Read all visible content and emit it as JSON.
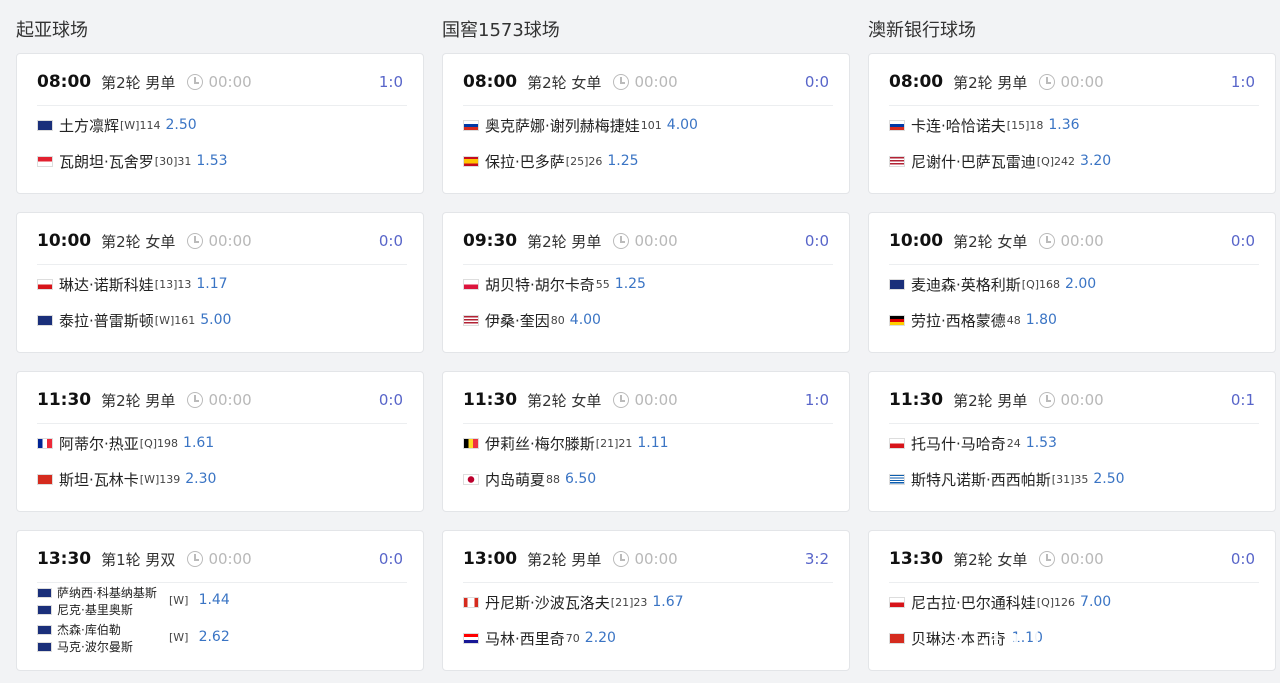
{
  "courts": [
    {
      "name": "起亚球场",
      "matches": [
        {
          "time": "08:00",
          "round": "第2轮 男单",
          "elapsed": "00:00",
          "score": "1:0",
          "p1": {
            "name": "土方凛辉",
            "seed": "[W]114",
            "odds": "2.50",
            "flag": "AUS"
          },
          "p2": {
            "name": "瓦朗坦·瓦舍罗",
            "seed": "[30]31",
            "odds": "1.53",
            "flag": "MON"
          }
        },
        {
          "time": "10:00",
          "round": "第2轮 女单",
          "elapsed": "00:00",
          "score": "0:0",
          "p1": {
            "name": "琳达·诺斯科娃",
            "seed": "[13]13",
            "odds": "1.17",
            "flag": "CZE"
          },
          "p2": {
            "name": "泰拉·普雷斯顿",
            "seed": "[W]161",
            "odds": "5.00",
            "flag": "AUS"
          }
        },
        {
          "time": "11:30",
          "round": "第2轮 男单",
          "elapsed": "00:00",
          "score": "0:0",
          "p1": {
            "name": "阿蒂尔·热亚",
            "seed": "[Q]198",
            "odds": "1.61",
            "flag": "FRA"
          },
          "p2": {
            "name": "斯坦·瓦林卡",
            "seed": "[W]139",
            "odds": "2.30",
            "flag": "SUI"
          }
        },
        {
          "time": "13:30",
          "round": "第1轮 男双",
          "elapsed": "00:00",
          "score": "0:0",
          "team1": {
            "players": [
              "萨纳西·科基纳基斯",
              "尼克·基里奥斯"
            ],
            "flags": [
              "AUS",
              "AUS"
            ],
            "seed": "[W]",
            "odds": "1.44"
          },
          "team2": {
            "players": [
              "杰森·库伯勒",
              "马克·波尔曼斯"
            ],
            "flags": [
              "AUS",
              "AUS"
            ],
            "seed": "[W]",
            "odds": "2.62"
          }
        }
      ]
    },
    {
      "name": "国窖1573球场",
      "matches": [
        {
          "time": "08:00",
          "round": "第2轮 女单",
          "elapsed": "00:00",
          "score": "0:0",
          "p1": {
            "name": "奥克萨娜·谢列赫梅捷娃",
            "seed": "101",
            "odds": "4.00",
            "flag": "RUS"
          },
          "p2": {
            "name": "保拉·巴多萨",
            "seed": "[25]26",
            "odds": "1.25",
            "flag": "ESP"
          }
        },
        {
          "time": "09:30",
          "round": "第2轮 男单",
          "elapsed": "00:00",
          "score": "0:0",
          "p1": {
            "name": "胡贝特·胡尔卡奇",
            "seed": "55",
            "odds": "1.25",
            "flag": "POL"
          },
          "p2": {
            "name": "伊桑·奎因",
            "seed": "80",
            "odds": "4.00",
            "flag": "USA"
          }
        },
        {
          "time": "11:30",
          "round": "第2轮 女单",
          "elapsed": "00:00",
          "score": "1:0",
          "p1": {
            "name": "伊莉丝·梅尔滕斯",
            "seed": "[21]21",
            "odds": "1.11",
            "flag": "BEL"
          },
          "p2": {
            "name": "内岛萌夏",
            "seed": "88",
            "odds": "6.50",
            "flag": "JPN"
          }
        },
        {
          "time": "13:00",
          "round": "第2轮 男单",
          "elapsed": "00:00",
          "score": "3:2",
          "p1": {
            "name": "丹尼斯·沙波瓦洛夫",
            "seed": "[21]23",
            "odds": "1.67",
            "flag": "CAN"
          },
          "p2": {
            "name": "马林·西里奇",
            "seed": "70",
            "odds": "2.20",
            "flag": "CRO"
          }
        }
      ]
    },
    {
      "name": "澳新银行球场",
      "matches": [
        {
          "time": "08:00",
          "round": "第2轮 男单",
          "elapsed": "00:00",
          "score": "1:0",
          "p1": {
            "name": "卡连·哈恰诺夫",
            "seed": "[15]18",
            "odds": "1.36",
            "flag": "RUS"
          },
          "p2": {
            "name": "尼谢什·巴萨瓦雷迪",
            "seed": "[Q]242",
            "odds": "3.20",
            "flag": "USA"
          }
        },
        {
          "time": "10:00",
          "round": "第2轮 女单",
          "elapsed": "00:00",
          "score": "0:0",
          "p1": {
            "name": "麦迪森·英格利斯",
            "seed": "[Q]168",
            "odds": "2.00",
            "flag": "AUS"
          },
          "p2": {
            "name": "劳拉·西格蒙德",
            "seed": "48",
            "odds": "1.80",
            "flag": "GER"
          }
        },
        {
          "time": "11:30",
          "round": "第2轮 男单",
          "elapsed": "00:00",
          "score": "0:1",
          "p1": {
            "name": "托马什·马哈奇",
            "seed": "24",
            "odds": "1.53",
            "flag": "CZE"
          },
          "p2": {
            "name": "斯特凡诺斯·西西帕斯",
            "seed": "[31]35",
            "odds": "2.50",
            "flag": "GRE"
          }
        },
        {
          "time": "13:30",
          "round": "第2轮 女单",
          "elapsed": "00:00",
          "score": "0:0",
          "p1": {
            "name": "尼古拉·巴尔通科娃",
            "seed": "[Q]126",
            "odds": "7.00",
            "flag": "CZE"
          },
          "p2": {
            "name": "贝琳达·本西奇",
            "seed": "",
            "odds": "1.10",
            "flag": "SUI"
          }
        }
      ]
    }
  ]
}
